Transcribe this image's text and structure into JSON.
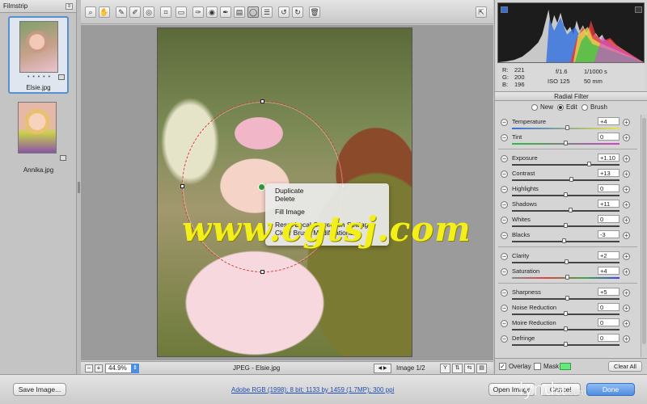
{
  "filmstrip": {
    "title": "Filmstrip",
    "items": [
      {
        "name": "Elsie.jpg",
        "selected": true,
        "rating_dots": "• • • • •"
      },
      {
        "name": "Annika.jpg",
        "selected": false
      }
    ]
  },
  "toolbar": {
    "tools": [
      "zoom-icon",
      "hand-icon",
      "white-balance-icon",
      "color-sampler-icon",
      "targeted-adjustment-icon",
      "crop-icon",
      "straighten-icon",
      "spot-removal-icon",
      "red-eye-icon",
      "adjustment-brush-icon",
      "graduated-filter-icon",
      "radial-filter-icon",
      "preferences-icon",
      "rotate-left-icon",
      "rotate-right-icon",
      "trash-icon"
    ],
    "active_tool": "radial-filter-icon"
  },
  "context_menu": {
    "items": [
      "Duplicate",
      "Delete",
      "Fill Image",
      "Reset Local Correction Settings",
      "Clear Brush Modifications"
    ]
  },
  "watermark": "www.cgtsj.com",
  "canvas_bar": {
    "zoom": "44.9%",
    "file_label": "JPEG  -  Elsie.jpg",
    "image_count": "Image 1/2"
  },
  "readout": {
    "r_label": "R:",
    "r": "221",
    "g_label": "G:",
    "g": "200",
    "b_label": "B:",
    "b": "196",
    "aperture": "f/1.6",
    "shutter": "1/1000 s",
    "iso": "ISO 125",
    "focal": "50 mm"
  },
  "panel": {
    "title": "Radial Filter",
    "modes": [
      "New",
      "Edit",
      "Brush"
    ],
    "selected_mode": "Edit",
    "sliders": [
      {
        "label": "Temperature",
        "value": "+4",
        "position": 0.52
      },
      {
        "label": "Tint",
        "value": "0",
        "position": 0.5
      },
      {
        "label": "Exposure",
        "value": "+1.10",
        "position": 0.72
      },
      {
        "label": "Contrast",
        "value": "+13",
        "position": 0.56
      },
      {
        "label": "Highlights",
        "value": "0",
        "position": 0.5
      },
      {
        "label": "Shadows",
        "value": "+11",
        "position": 0.55
      },
      {
        "label": "Whites",
        "value": "0",
        "position": 0.5
      },
      {
        "label": "Blacks",
        "value": "-3",
        "position": 0.49
      },
      {
        "label": "Clarity",
        "value": "+2",
        "position": 0.51
      },
      {
        "label": "Saturation",
        "value": "+4",
        "position": 0.52
      },
      {
        "label": "Sharpness",
        "value": "+5",
        "position": 0.52
      },
      {
        "label": "Noise Reduction",
        "value": "0",
        "position": 0.5
      },
      {
        "label": "Moire Reduction",
        "value": "0",
        "position": 0.5
      },
      {
        "label": "Defringe",
        "value": "0",
        "position": 0.5
      }
    ],
    "footer": {
      "overlay": "Overlay",
      "overlay_checked": true,
      "mask": "Mask",
      "mask_checked": false,
      "mask_color": "#64e87a",
      "clear_all": "Clear All"
    }
  },
  "bottom_bar": {
    "save_image": "Save Image...",
    "workflow": "Adobe RGB (1998); 8 bit; 1133 by 1459 (1.7MP); 300 ppi",
    "open_image": "Open Image",
    "cancel": "Cancel",
    "done": "Done",
    "logo": "lynda",
    "logo_suffix": ".com"
  }
}
